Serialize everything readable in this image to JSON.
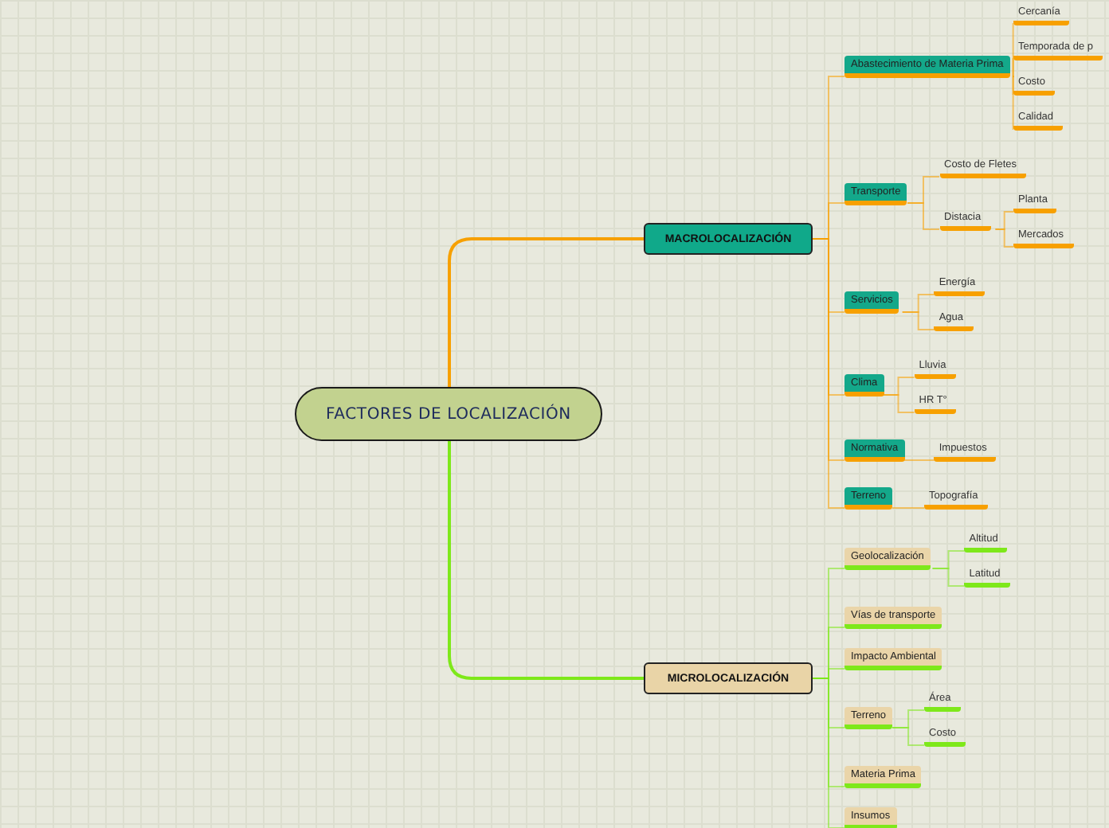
{
  "root": {
    "label": "FACTORES DE LOCALIZACIÓN"
  },
  "branches": [
    {
      "label": "MACROLOCALIZACIÓN",
      "kind": "teal",
      "color": "#f7a000",
      "children": [
        {
          "label": "Abastecimiento de Materia Prima",
          "children": [
            {
              "label": "Cercanía"
            },
            {
              "label": "Temporada de p"
            },
            {
              "label": "Costo"
            },
            {
              "label": "Calidad"
            }
          ]
        },
        {
          "label": "Transporte",
          "children": [
            {
              "label": "Costo de Fletes"
            },
            {
              "label": "Distacia",
              "children": [
                {
                  "label": "Planta"
                },
                {
                  "label": "Mercados"
                }
              ]
            }
          ]
        },
        {
          "label": "Servicios",
          "children": [
            {
              "label": "Energía"
            },
            {
              "label": "Agua"
            }
          ]
        },
        {
          "label": "Clima",
          "children": [
            {
              "label": "Lluvia"
            },
            {
              "label": "HR T°"
            }
          ]
        },
        {
          "label": "Normativa",
          "children": [
            {
              "label": "Impuestos"
            }
          ]
        },
        {
          "label": "Terreno",
          "children": [
            {
              "label": "Topografía"
            }
          ]
        }
      ]
    },
    {
      "label": "MICROLOCALIZACIÓN",
      "kind": "tan",
      "color": "#7ee81a",
      "children": [
        {
          "label": "Geolocalización",
          "children": [
            {
              "label": "Altitud"
            },
            {
              "label": "Latitud"
            }
          ]
        },
        {
          "label": "Vías de transporte"
        },
        {
          "label": "Impacto Ambiental"
        },
        {
          "label": "Terreno",
          "children": [
            {
              "label": "Área"
            },
            {
              "label": "Costo"
            }
          ]
        },
        {
          "label": "Materia Prima"
        },
        {
          "label": "Insumos"
        }
      ]
    }
  ]
}
